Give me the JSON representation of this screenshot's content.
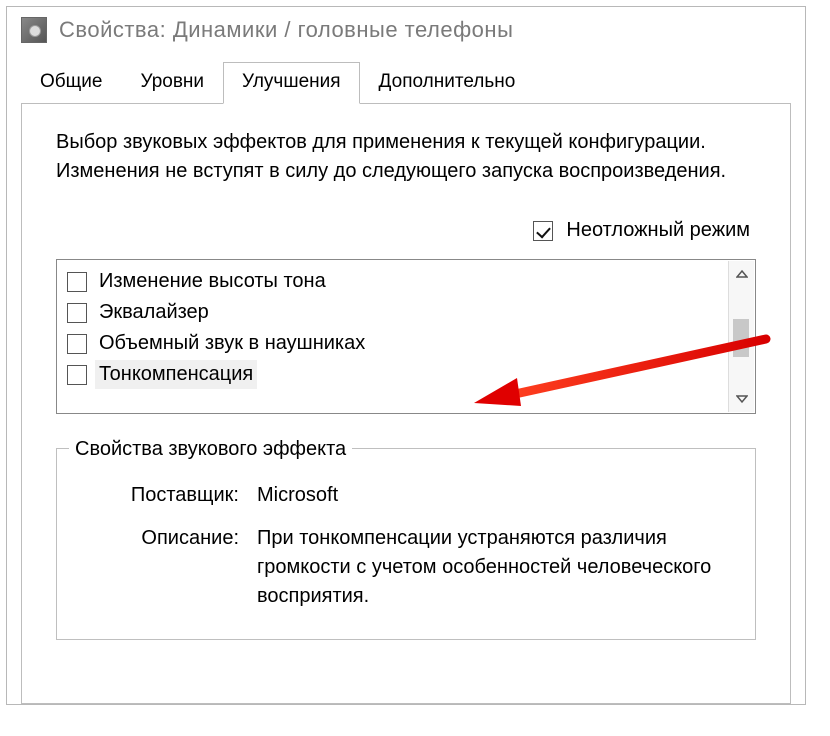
{
  "window": {
    "title": "Свойства: Динамики / головные телефоны"
  },
  "tabs": {
    "items": [
      {
        "label": "Общие"
      },
      {
        "label": "Уровни"
      },
      {
        "label": "Улучшения"
      },
      {
        "label": "Дополнительно"
      }
    ]
  },
  "content": {
    "intro": "Выбор звуковых эффектов для применения к текущей конфигурации. Изменения не вступят в силу до следующего запуска воспроизведения.",
    "urgent_label": "Неотложный режим",
    "effects": [
      {
        "label": "Изменение высоты тона"
      },
      {
        "label": "Эквалайзер"
      },
      {
        "label": "Объемный звук в наушниках"
      },
      {
        "label": "Тонкомпенсация"
      }
    ],
    "group_title": "Свойства звукового эффекта",
    "provider_label": "Поставщик:",
    "provider_value": "Microsoft",
    "desc_label": "Описание:",
    "desc_value": "При тонкомпенсации устраняются различия громкости с учетом особенностей человеческого восприятия."
  }
}
